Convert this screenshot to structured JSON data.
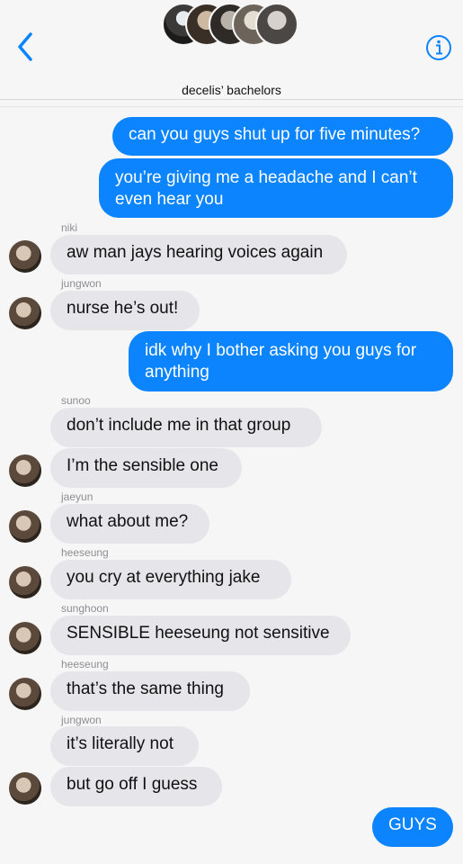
{
  "header": {
    "group_name": "decelis’ bachelors"
  },
  "messages": [
    {
      "id": "m1",
      "text": "can you guys shut up for five minutes?"
    },
    {
      "id": "m2",
      "text_line1": "you’re giving me a headache and I can’t",
      "text_line2": "even hear you"
    },
    {
      "id": "m3",
      "sender": "niki",
      "text": "aw man jays hearing voices again"
    },
    {
      "id": "m4",
      "sender": "jungwon",
      "text": "nurse he’s out!"
    },
    {
      "id": "m5",
      "text_line1": "idk why I bother asking you guys for",
      "text_line2": "anything"
    },
    {
      "id": "m6",
      "sender": "sunoo",
      "text": "don’t include me in that group"
    },
    {
      "id": "m7",
      "text": "I’m the sensible one"
    },
    {
      "id": "m8",
      "sender": "jaeyun",
      "text": "what about me?"
    },
    {
      "id": "m9",
      "sender": "heeseung",
      "text": "you cry at everything jake"
    },
    {
      "id": "m10",
      "sender": "sunghoon",
      "text": "SENSIBLE heeseung not sensitive"
    },
    {
      "id": "m11",
      "sender": "heeseung",
      "text": "that’s the same thing"
    },
    {
      "id": "m12",
      "sender": "jungwon",
      "text": "it’s literally not"
    },
    {
      "id": "m13",
      "text": "but go off I guess"
    },
    {
      "id": "m14",
      "text": "GUYS"
    }
  ],
  "colors": {
    "outgoing": "#0b84fe",
    "incoming": "#e5e5ea",
    "accent": "#0b84fe"
  }
}
